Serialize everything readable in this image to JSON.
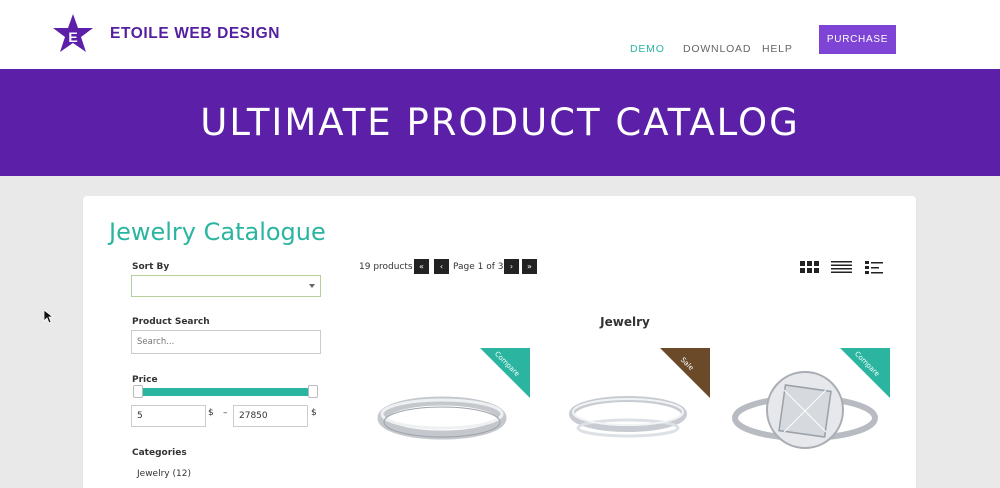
{
  "header": {
    "brand": "ETOILE WEB DESIGN",
    "nav": [
      "DEMO",
      "DOWNLOAD",
      "HELP"
    ],
    "purchase_label": "PURCHASE",
    "colors": {
      "accent": "#2bb5a0",
      "brand": "#5c1fa8",
      "button": "#7e44d6"
    }
  },
  "banner": {
    "title": "ULTIMATE PRODUCT CATALOG"
  },
  "catalog": {
    "title": "Jewelry Catalogue",
    "sort_label": "Sort By",
    "search_label": "Product Search",
    "search_placeholder": "Search...",
    "price_label": "Price",
    "price_min": "5",
    "price_max": "27850",
    "currency": "$",
    "dash": "–",
    "categories_label": "Categories",
    "category_item": "Jewelry  (12)"
  },
  "pagination": {
    "count": "19 products",
    "first": "«",
    "prev": "‹",
    "page_text": "Page 1 of 3",
    "next": "›",
    "last": "»"
  },
  "products": {
    "section_title": "Jewelry",
    "items": [
      {
        "badge": "Compare",
        "badge_color": "#2bb5a0",
        "icon": "ring-band-icon"
      },
      {
        "badge": "Sale",
        "badge_color": "#6b4a2a",
        "icon": "ring-thin-icon"
      },
      {
        "badge": "Compare",
        "badge_color": "#2bb5a0",
        "icon": "ring-diamond-icon"
      }
    ]
  }
}
